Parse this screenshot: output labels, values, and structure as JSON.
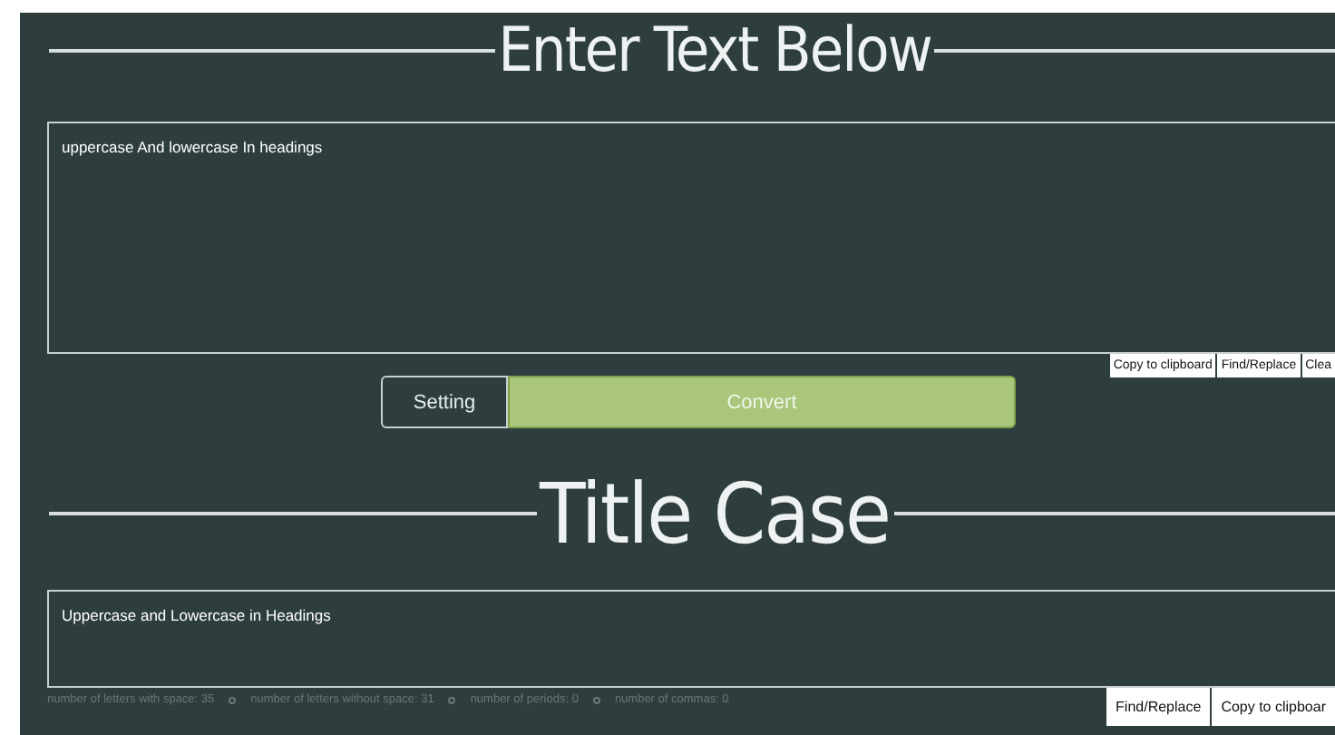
{
  "input_section": {
    "heading": "Enter Text Below",
    "text": "uppercase And lowercase In headings",
    "tools": [
      "Copy to clipboard",
      "Find/Replace",
      "Clea"
    ]
  },
  "actions": [
    {
      "label": "Setting",
      "kind": "outline"
    },
    {
      "label": "Convert",
      "kind": "primary"
    }
  ],
  "output_section": {
    "heading": "Title Case",
    "text": "Uppercase and Lowercase in Headings",
    "stats": [
      "number of letters with space: 35",
      "number of letters without space: 31",
      "number of periods: 0",
      "number of commas: 0"
    ],
    "tools": [
      "Find/Replace",
      "Copy to clipboar"
    ]
  }
}
